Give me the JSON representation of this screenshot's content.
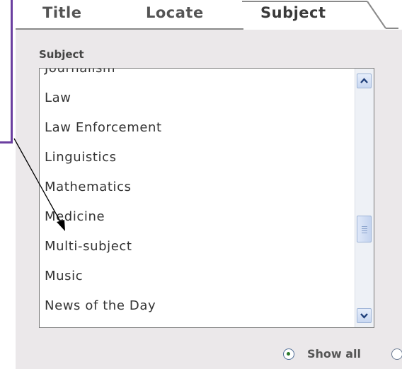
{
  "tabs": [
    {
      "label": "Title"
    },
    {
      "label": "Locate"
    },
    {
      "label": "Subject"
    }
  ],
  "active_tab": "Subject",
  "subject_label": "Subject",
  "subjects": [
    "Journalism",
    "Law",
    "Law Enforcement",
    "Linguistics",
    "Mathematics",
    "Medicine",
    "Multi-subject",
    "Music",
    "News of the Day"
  ],
  "radio": {
    "show_all_label": "Show all",
    "show_all_selected": true
  },
  "colors": {
    "panel_bg": "#ebe8ea",
    "accent_purple": "#6b3fa0",
    "arrow": "#000000"
  }
}
